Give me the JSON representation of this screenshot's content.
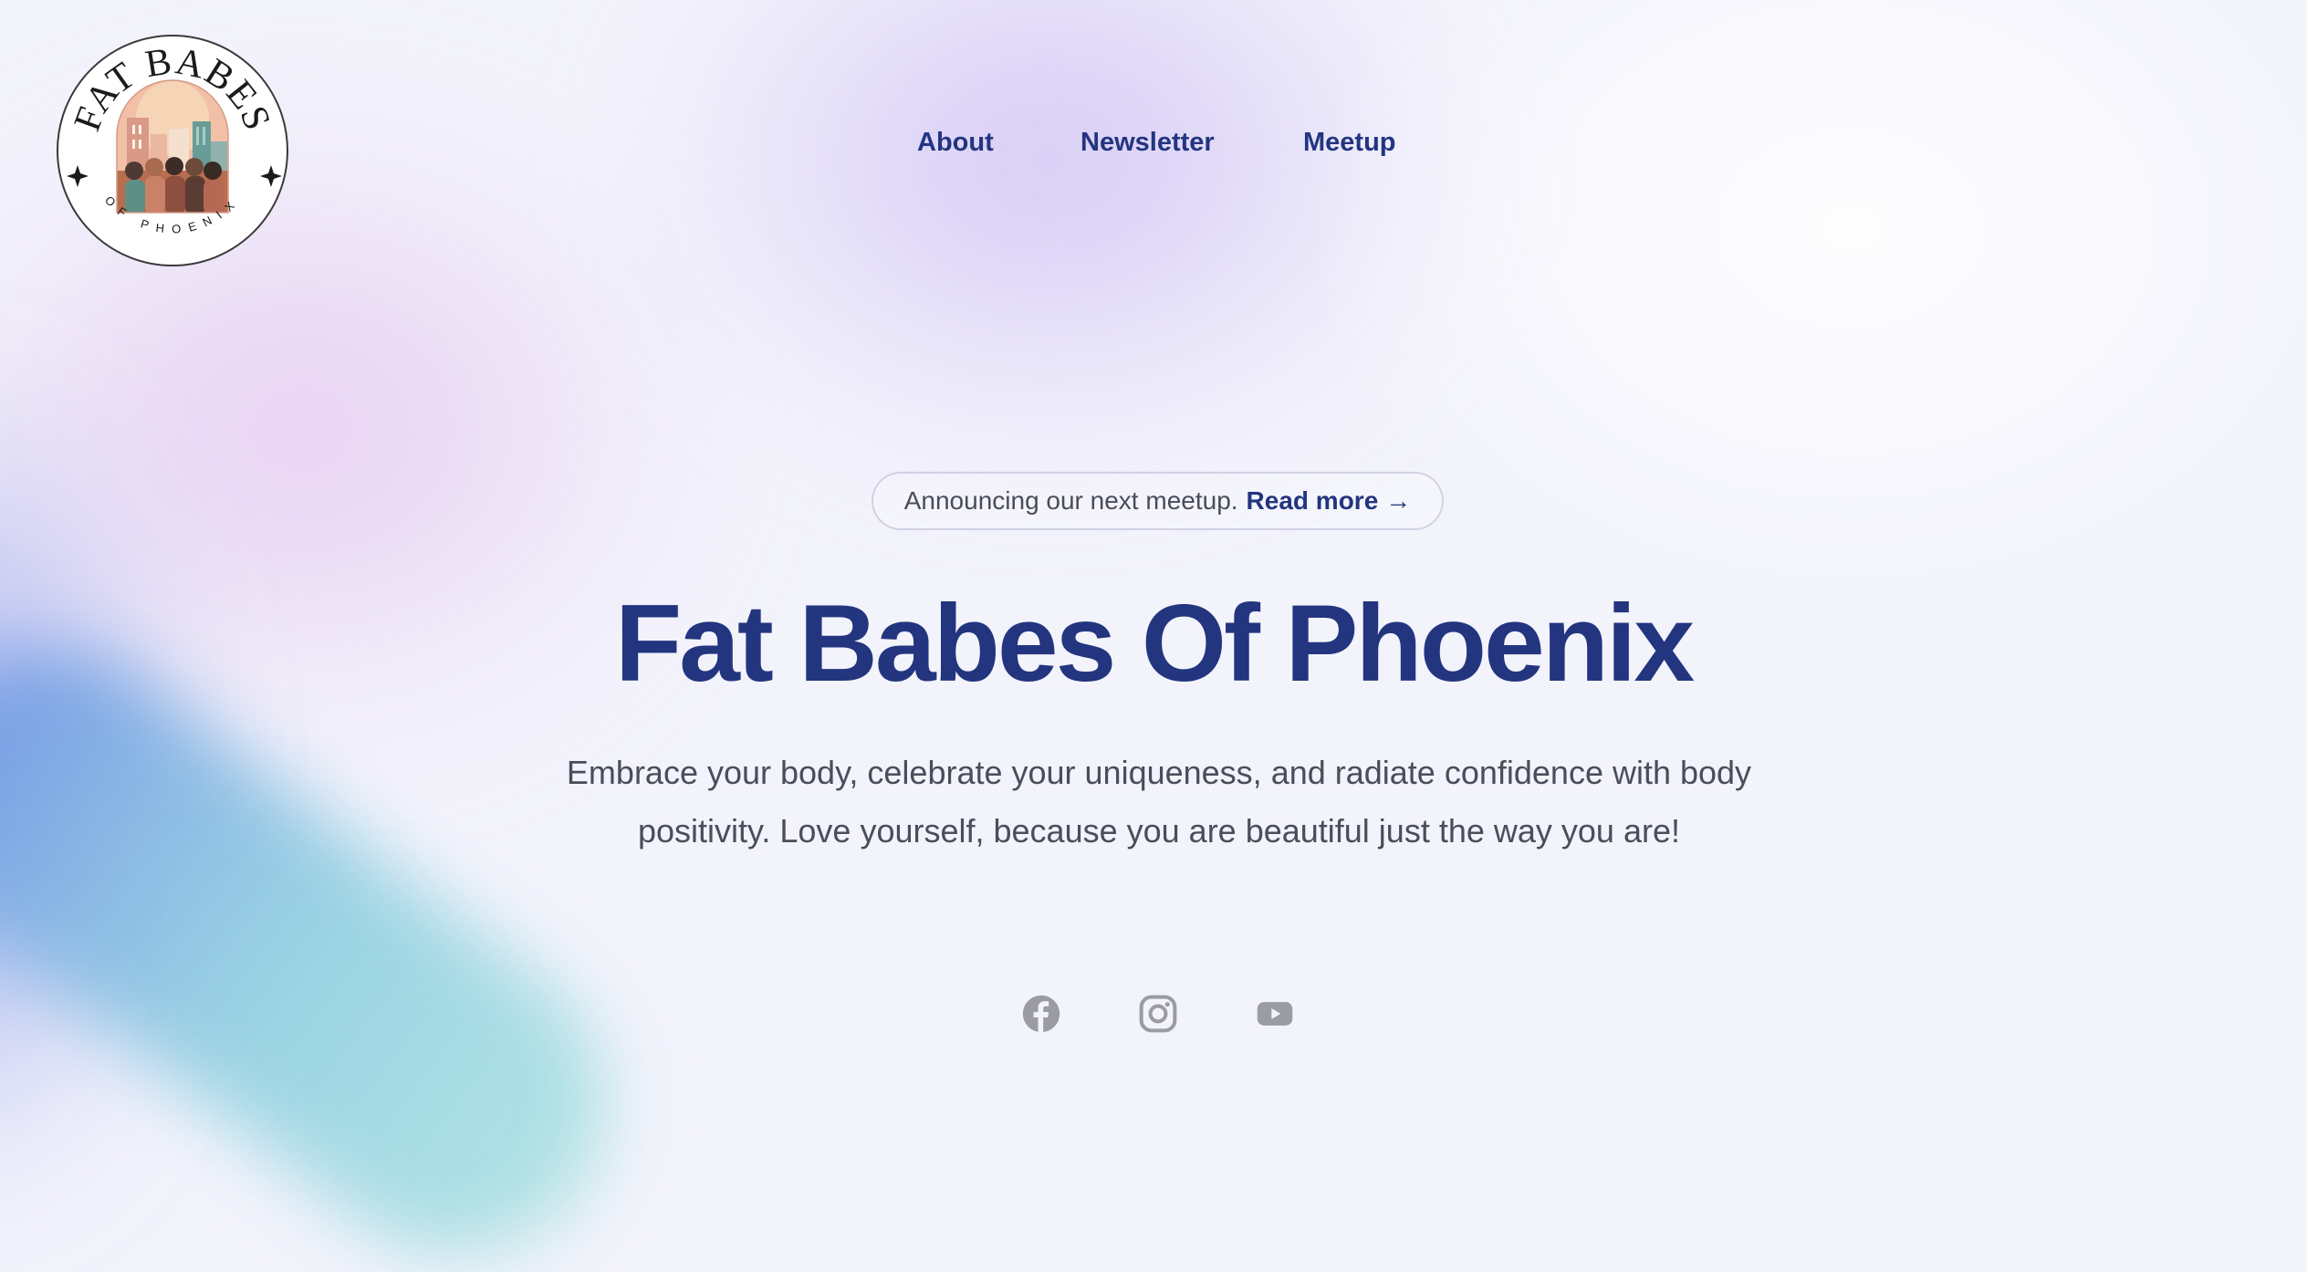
{
  "logo": {
    "title_text": "FAT BABES",
    "subtitle_text": "OF PHOENIX"
  },
  "nav": {
    "about": "About",
    "newsletter": "Newsletter",
    "meetup": "Meetup"
  },
  "announcement": {
    "text": "Announcing our next meetup.",
    "link": "Read more",
    "arrow": "→"
  },
  "hero": {
    "title": "Fat Babes Of Phoenix",
    "tagline": "Embrace your body, celebrate your uniqueness, and radiate confidence with body positivity. Love yourself, because you are beautiful just the way you are!"
  },
  "social": [
    {
      "icon": "facebook-icon"
    },
    {
      "icon": "instagram-icon"
    },
    {
      "icon": "youtube-icon"
    }
  ],
  "colors": {
    "brand_navy": "#23357f",
    "body_text": "#4a4d5b",
    "icon_gray": "#9b9ca3"
  }
}
